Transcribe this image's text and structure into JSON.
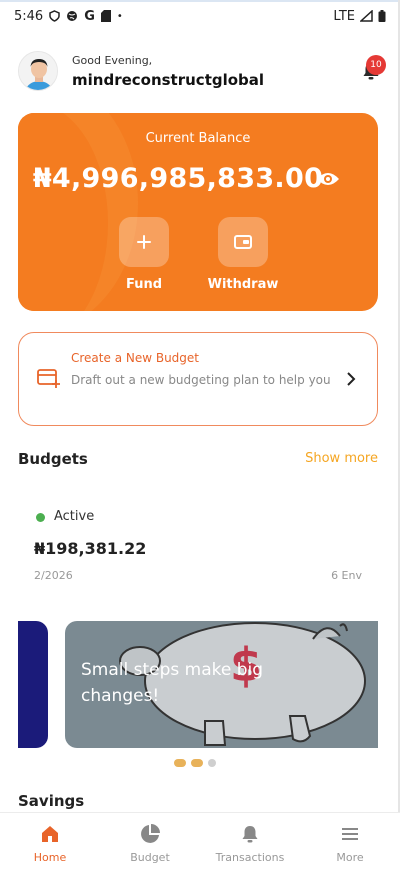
{
  "status_bar": {
    "time": "5:46",
    "network": "LTE"
  },
  "header": {
    "greeting": "Good Evening,",
    "username": "mindreconstructglobal",
    "notification_count": "10"
  },
  "balance_card": {
    "label": "Current Balance",
    "amount": "₦4,996,985,833.00",
    "actions": [
      {
        "label": "Fund",
        "icon": "plus-icon"
      },
      {
        "label": "Withdraw",
        "icon": "wallet-icon"
      }
    ]
  },
  "create_budget": {
    "title": "Create a New Budget",
    "description": "Draft out a new budgeting plan to help you"
  },
  "budgets": {
    "title": "Budgets",
    "show_more": "Show more",
    "card": {
      "status": "Active",
      "amount": "₦198,381.22",
      "date": "2/2026",
      "envelopes": "6 Env"
    }
  },
  "carousel": {
    "text": "Small steps make big changes!",
    "slides": 3,
    "active_index": 1
  },
  "savings": {
    "title": "Savings"
  },
  "bottom_nav": [
    {
      "label": "Home",
      "icon": "home-icon",
      "active": true
    },
    {
      "label": "Budget",
      "icon": "pie-chart-icon",
      "active": false
    },
    {
      "label": "Transactions",
      "icon": "bell-icon",
      "active": false
    },
    {
      "label": "More",
      "icon": "menu-icon",
      "active": false
    }
  ],
  "colors": {
    "accent": "#f47c20",
    "link": "#f5a623",
    "active_status": "#4caf50",
    "badge": "#e53935"
  }
}
